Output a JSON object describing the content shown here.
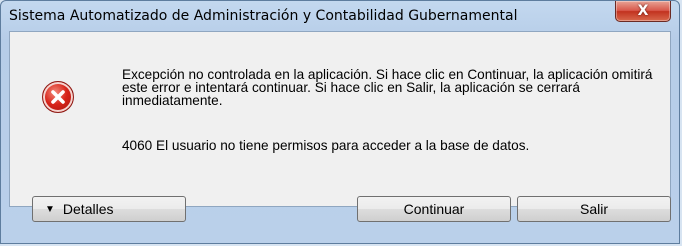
{
  "window": {
    "title": "Sistema Automatizado de Administración y Contabilidad Gubernamental"
  },
  "close_glyph": "X",
  "message": {
    "line1": "Excepción no controlada en la aplicación. Si hace clic en Continuar, la aplicación omitirá este error e intentará continuar. Si hace clic en Salir, la aplicación se cerrará inmediatamente.",
    "line2": "4060 El usuario no tiene permisos para acceder a la base de datos."
  },
  "buttons": {
    "details_caret": "▼",
    "details": "Detalles",
    "continue": "Continuar",
    "exit": "Salir"
  },
  "icons": {
    "error": "error-icon"
  },
  "colors": {
    "error_red": "#d7241a",
    "close_red": "#c2321f",
    "title_bg": "#c3d8ef"
  }
}
